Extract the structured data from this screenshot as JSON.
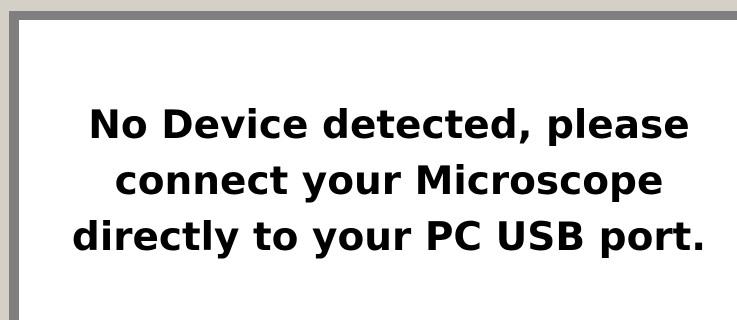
{
  "dialog": {
    "message_lines": [
      "No Device detected, please",
      "connect your Microscope",
      "directly to your PC USB port."
    ]
  },
  "colors": {
    "frame": "#7f7f7f",
    "outer_frame": "#d4d0c8",
    "background": "#ffffff",
    "text": "#000000"
  }
}
